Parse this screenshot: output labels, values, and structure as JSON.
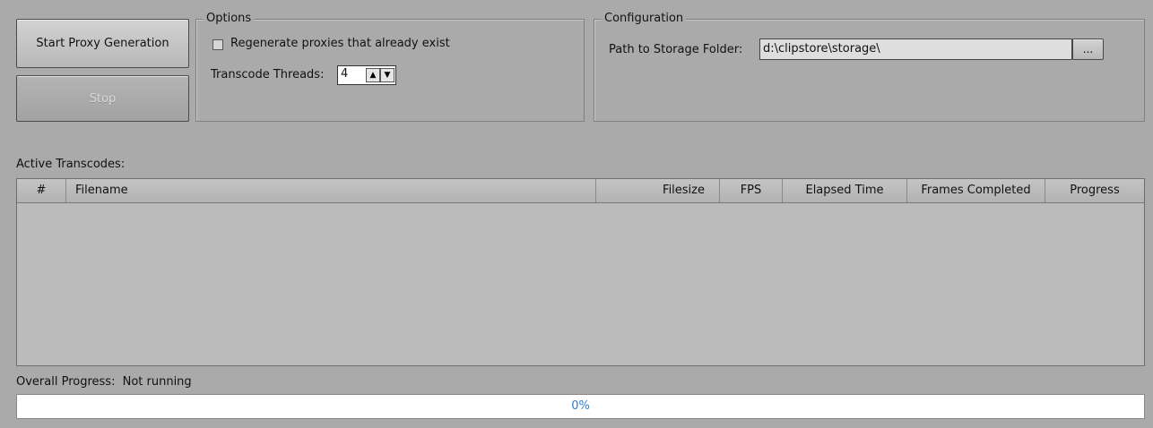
{
  "buttons": {
    "start_label": "Start Proxy Generation",
    "stop_label": "Stop"
  },
  "options": {
    "legend": "Options",
    "regenerate_label": "Regenerate proxies that already exist",
    "regenerate_checked": false,
    "threads_label": "Transcode Threads:",
    "threads_value": "4"
  },
  "configuration": {
    "legend": "Configuration",
    "path_label": "Path to Storage Folder:",
    "path_value": "d:\\clipstore\\storage\\",
    "browse_label": "..."
  },
  "transcodes": {
    "title": "Active Transcodes:",
    "columns": [
      "#",
      "Filename",
      "Filesize",
      "FPS",
      "Elapsed Time",
      "Frames Completed",
      "Progress"
    ],
    "rows": []
  },
  "overall": {
    "label": "Overall Progress:",
    "status": "Not running",
    "percent_text": "0%",
    "percent": 0
  },
  "icons": {
    "spin_up": "up-arrow-icon",
    "spin_down": "down-arrow-icon"
  },
  "colors": {
    "window_bg": "#aaaaaa",
    "progress_text": "#2d7dd2"
  }
}
